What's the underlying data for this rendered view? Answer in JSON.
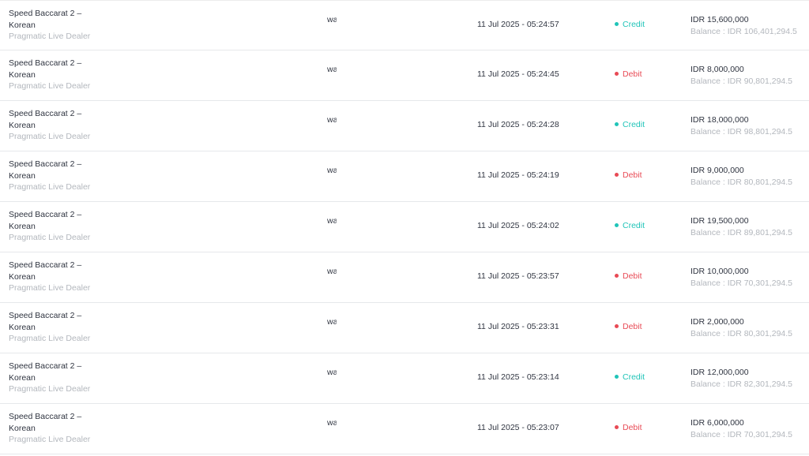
{
  "transactions": [
    {
      "game": "Speed Baccarat 2 – Korean",
      "provider": "Pragmatic Live Dealer",
      "user": "wa",
      "datetime": "11 Jul 2025 - 05:24:57",
      "type": "Credit",
      "type_key": "credit",
      "amount": "IDR 15,600,000",
      "balance": "Balance : IDR 106,401,294.5"
    },
    {
      "game": "Speed Baccarat 2 – Korean",
      "provider": "Pragmatic Live Dealer",
      "user": "wa",
      "datetime": "11 Jul 2025 - 05:24:45",
      "type": "Debit",
      "type_key": "debit",
      "amount": "IDR 8,000,000",
      "balance": "Balance : IDR 90,801,294.5"
    },
    {
      "game": "Speed Baccarat 2 – Korean",
      "provider": "Pragmatic Live Dealer",
      "user": "wa",
      "datetime": "11 Jul 2025 - 05:24:28",
      "type": "Credit",
      "type_key": "credit",
      "amount": "IDR 18,000,000",
      "balance": "Balance : IDR 98,801,294.5"
    },
    {
      "game": "Speed Baccarat 2 – Korean",
      "provider": "Pragmatic Live Dealer",
      "user": "wa",
      "datetime": "11 Jul 2025 - 05:24:19",
      "type": "Debit",
      "type_key": "debit",
      "amount": "IDR 9,000,000",
      "balance": "Balance : IDR 80,801,294.5"
    },
    {
      "game": "Speed Baccarat 2 – Korean",
      "provider": "Pragmatic Live Dealer",
      "user": "wa",
      "datetime": "11 Jul 2025 - 05:24:02",
      "type": "Credit",
      "type_key": "credit",
      "amount": "IDR 19,500,000",
      "balance": "Balance : IDR 89,801,294.5"
    },
    {
      "game": "Speed Baccarat 2 – Korean",
      "provider": "Pragmatic Live Dealer",
      "user": "wa",
      "datetime": "11 Jul 2025 - 05:23:57",
      "type": "Debit",
      "type_key": "debit",
      "amount": "IDR 10,000,000",
      "balance": "Balance : IDR 70,301,294.5"
    },
    {
      "game": "Speed Baccarat 2 – Korean",
      "provider": "Pragmatic Live Dealer",
      "user": "wa",
      "datetime": "11 Jul 2025 - 05:23:31",
      "type": "Debit",
      "type_key": "debit",
      "amount": "IDR 2,000,000",
      "balance": "Balance : IDR 80,301,294.5"
    },
    {
      "game": "Speed Baccarat 2 – Korean",
      "provider": "Pragmatic Live Dealer",
      "user": "wa",
      "datetime": "11 Jul 2025 - 05:23:14",
      "type": "Credit",
      "type_key": "credit",
      "amount": "IDR 12,000,000",
      "balance": "Balance : IDR 82,301,294.5"
    },
    {
      "game": "Speed Baccarat 2 – Korean",
      "provider": "Pragmatic Live Dealer",
      "user": "wa",
      "datetime": "11 Jul 2025 - 05:23:07",
      "type": "Debit",
      "type_key": "debit",
      "amount": "IDR 6,000,000",
      "balance": "Balance : IDR 70,301,294.5"
    }
  ],
  "colors": {
    "credit": "#20c4b8",
    "debit": "#e84a55",
    "text": "#2f3440",
    "muted": "#b3b7bd"
  }
}
